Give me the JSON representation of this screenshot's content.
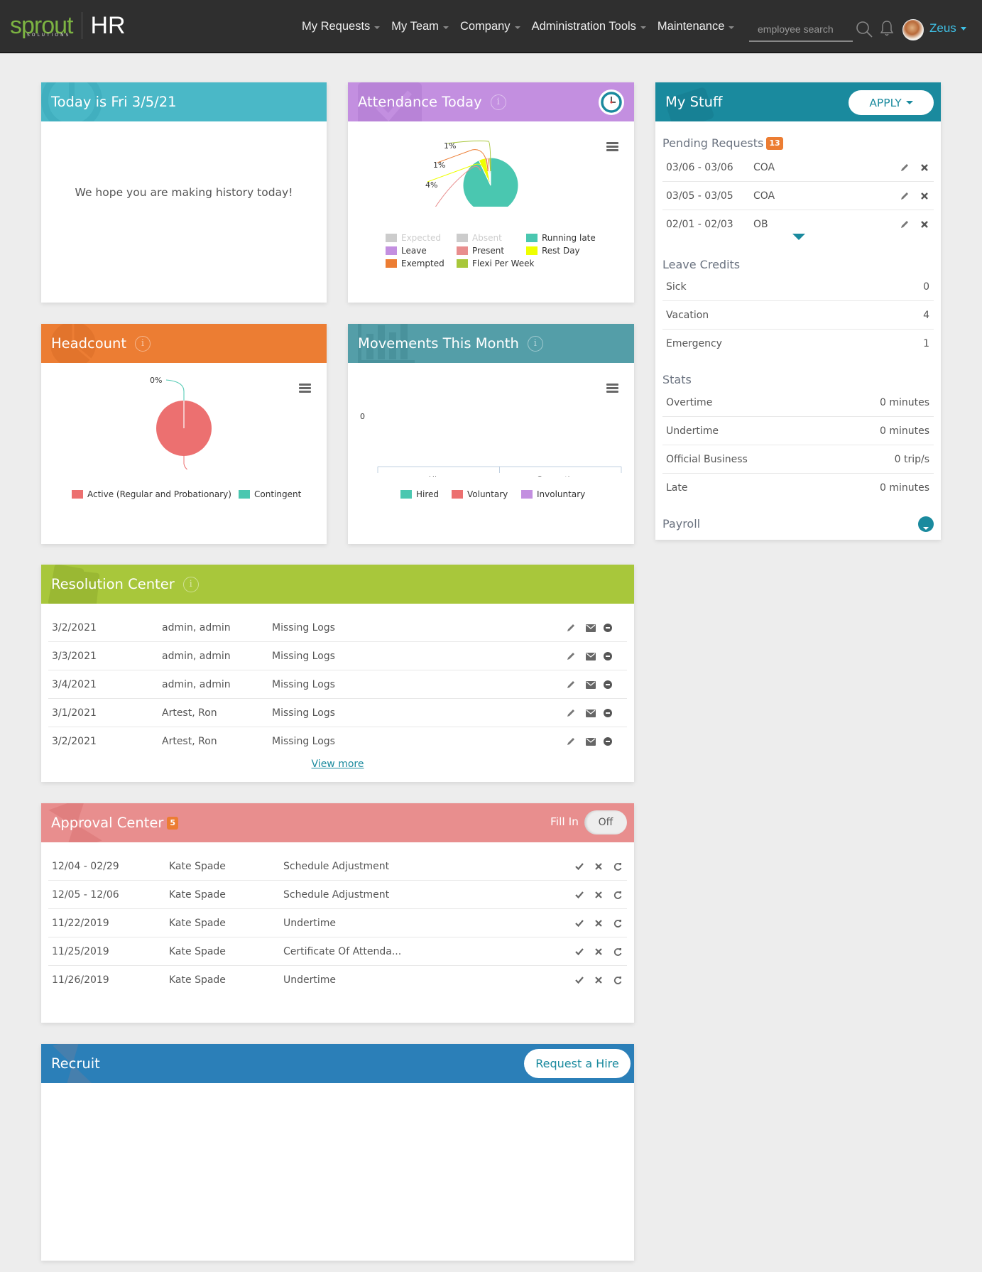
{
  "navbar": {
    "logo_text": "sprout",
    "logo_sub": "SOLUTIONS",
    "logo_product": "HR",
    "menu": [
      {
        "label": "My Requests"
      },
      {
        "label": "My Team"
      },
      {
        "label": "Company"
      },
      {
        "label": "Administration Tools"
      },
      {
        "label": "Maintenance"
      }
    ],
    "search_placeholder": "employee search",
    "user_name": "Zeus"
  },
  "today": {
    "title": "Today is Fri 3/5/21",
    "message": "We hope you are making history today!"
  },
  "attendance": {
    "title": "Attendance Today",
    "chart_data": {
      "type": "pie",
      "title": "Attendance Today",
      "slices": [
        {
          "name": "Running late",
          "value": 93,
          "label": "93%",
          "color": "#4ac7b0"
        },
        {
          "name": "Rest Day",
          "value": 4,
          "label": "4%",
          "color": "#eeff00"
        },
        {
          "name": "Present",
          "value": 1,
          "label": "1%",
          "color": "#e88e8e"
        },
        {
          "name": "Exempted",
          "value": 1,
          "label": "1%",
          "color": "#ec7d33"
        },
        {
          "name": "Flexi Per Week",
          "value": 1,
          "label": "1%",
          "color": "#a8c73b"
        }
      ],
      "legend": [
        {
          "name": "Expected",
          "color": "#cccccc",
          "disabled": true
        },
        {
          "name": "Absent",
          "color": "#cccccc",
          "disabled": true
        },
        {
          "name": "Running late",
          "color": "#4ac7b0",
          "disabled": false
        },
        {
          "name": "Leave",
          "color": "#c38fe0",
          "disabled": false
        },
        {
          "name": "Present",
          "color": "#e88e8e",
          "disabled": false
        },
        {
          "name": "Rest Day",
          "color": "#eeff00",
          "disabled": false
        },
        {
          "name": "Exempted",
          "color": "#ec7d33",
          "disabled": false
        },
        {
          "name": "Flexi Per Week",
          "color": "#a8c73b",
          "disabled": false
        }
      ],
      "legend_position": "bottom"
    }
  },
  "headcount": {
    "title": "Headcount",
    "chart_data": {
      "type": "pie",
      "title": "Headcount",
      "slices": [
        {
          "name": "Active (Regular and Probationary)",
          "value": 100,
          "label": "100%",
          "color": "#ec7070"
        },
        {
          "name": "Contingent",
          "value": 0,
          "label": "0%",
          "color": "#4ac7b0"
        }
      ],
      "legend_position": "bottom"
    }
  },
  "movements": {
    "title": "Movements This Month",
    "chart_data": {
      "type": "bar",
      "title": "Movements This Month",
      "categories": [
        "Hires",
        "Separations"
      ],
      "series": [
        {
          "name": "Hired",
          "values": [
            0,
            0
          ],
          "color": "#4ac7b0"
        },
        {
          "name": "Voluntary",
          "values": [
            0,
            0
          ],
          "color": "#ec7070"
        },
        {
          "name": "Involuntary",
          "values": [
            0,
            0
          ],
          "color": "#c38fe0"
        }
      ],
      "y_ticks": [
        "0"
      ],
      "ylim": [
        0,
        0
      ],
      "legend_position": "bottom"
    }
  },
  "mystuff": {
    "title": "My Stuff",
    "apply_label": "APPLY",
    "pending": {
      "title": "Pending Requests",
      "count": "13",
      "rows": [
        {
          "dates": "03/06 - 03/06",
          "type": "COA"
        },
        {
          "dates": "03/05 - 03/05",
          "type": "COA"
        },
        {
          "dates": "02/01 - 02/03",
          "type": "OB"
        }
      ]
    },
    "leave_credits": {
      "title": "Leave Credits",
      "rows": [
        {
          "label": "Sick",
          "value": "0"
        },
        {
          "label": "Vacation",
          "value": "4"
        },
        {
          "label": "Emergency",
          "value": "1"
        }
      ]
    },
    "stats": {
      "title": "Stats",
      "rows": [
        {
          "label": "Overtime",
          "value": "0 minutes"
        },
        {
          "label": "Undertime",
          "value": "0 minutes"
        },
        {
          "label": "Official Business",
          "value": "0 trip/s"
        },
        {
          "label": "Late",
          "value": "0 minutes"
        }
      ]
    },
    "payroll_title": "Payroll"
  },
  "resolution": {
    "title": "Resolution Center",
    "rows": [
      {
        "date": "3/2/2021",
        "name": "admin, admin",
        "issue": "Missing Logs"
      },
      {
        "date": "3/3/2021",
        "name": "admin, admin",
        "issue": "Missing Logs"
      },
      {
        "date": "3/4/2021",
        "name": "admin, admin",
        "issue": "Missing Logs"
      },
      {
        "date": "3/1/2021",
        "name": "Artest, Ron",
        "issue": "Missing Logs"
      },
      {
        "date": "3/2/2021",
        "name": "Artest, Ron",
        "issue": "Missing Logs"
      }
    ],
    "view_more": "View more"
  },
  "approval": {
    "title": "Approval Center",
    "count": "5",
    "fill_in_label": "Fill In",
    "toggle_state": "Off",
    "rows": [
      {
        "date": "12/04 - 02/29",
        "name": "Kate Spade",
        "type": "Schedule Adjustment"
      },
      {
        "date": "12/05 - 12/06",
        "name": "Kate Spade",
        "type": "Schedule Adjustment"
      },
      {
        "date": "11/22/2019",
        "name": "Kate Spade",
        "type": "Undertime"
      },
      {
        "date": "11/25/2019",
        "name": "Kate Spade",
        "type": "Certificate Of Attenda..."
      },
      {
        "date": "11/26/2019",
        "name": "Kate Spade",
        "type": "Undertime"
      }
    ]
  },
  "recruit": {
    "title": "Recruit",
    "request_hire_label": "Request a Hire"
  }
}
